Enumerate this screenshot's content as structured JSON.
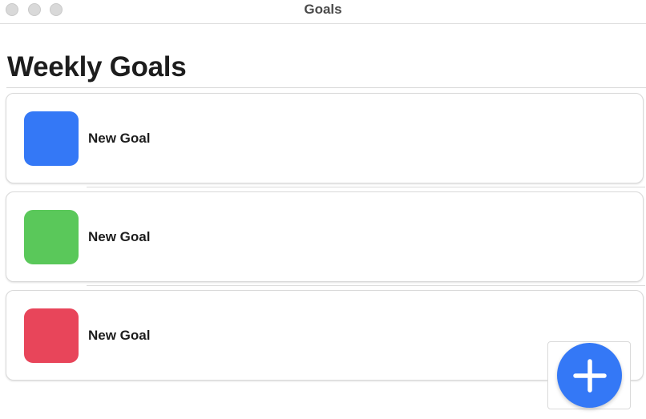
{
  "window": {
    "title": "Goals"
  },
  "page": {
    "heading": "Weekly Goals"
  },
  "goals": [
    {
      "label": "New Goal",
      "color": "#3478f6"
    },
    {
      "label": "New Goal",
      "color": "#5ac85a"
    },
    {
      "label": "New Goal",
      "color": "#e8455a"
    }
  ],
  "add_button": {
    "icon": "plus-icon",
    "color": "#3478f6"
  }
}
